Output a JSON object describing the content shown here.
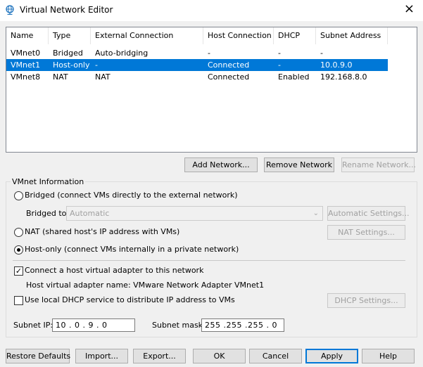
{
  "window": {
    "title": "Virtual Network Editor",
    "close_glyph": "×"
  },
  "table": {
    "headers": [
      "Name",
      "Type",
      "External Connection",
      "Host Connection",
      "DHCP",
      "Subnet Address"
    ],
    "rows": [
      [
        "VMnet0",
        "Bridged",
        "Auto-bridging",
        "-",
        "-",
        "-"
      ],
      [
        "VMnet1",
        "Host-only",
        "-",
        "Connected",
        "-",
        "10.0.9.0"
      ],
      [
        "VMnet8",
        "NAT",
        "NAT",
        "Connected",
        "Enabled",
        "192.168.8.0"
      ]
    ],
    "selected_row": 1
  },
  "network_buttons": {
    "add": "Add Network...",
    "remove": "Remove Network",
    "rename": "Rename Network..."
  },
  "vmnet_info": {
    "legend": "VMnet Information",
    "bridged_label": "Bridged (connect VMs directly to the external network)",
    "bridged_to_label": "Bridged to:",
    "bridged_to_value": "Automatic",
    "auto_settings": "Automatic Settings...",
    "nat_label": "NAT (shared host's IP address with VMs)",
    "nat_settings": "NAT Settings...",
    "hostonly_label": "Host-only (connect VMs internally in a private network)",
    "selected_mode": "host-only",
    "connect_adapter_label": "Connect a host virtual adapter to this network",
    "connect_adapter_checked": true,
    "adapter_name_label": "Host virtual adapter name: VMware Network Adapter VMnet1",
    "dhcp_label": "Use local DHCP service to distribute IP address to VMs",
    "dhcp_checked": false,
    "dhcp_settings": "DHCP Settings...",
    "subnet_ip_label": "Subnet IP:",
    "subnet_ip_value": "10 .  0 .  9 .  0",
    "subnet_mask_label": "Subnet mask:",
    "subnet_mask_value": "255 .255 .255 .  0"
  },
  "footer_buttons": {
    "restore": "Restore Defaults",
    "import": "Import...",
    "export": "Export...",
    "ok": "OK",
    "cancel": "Cancel",
    "apply": "Apply",
    "help": "Help"
  },
  "colors": {
    "selection": "#0078d7",
    "accent_icon": "#1e73be"
  }
}
